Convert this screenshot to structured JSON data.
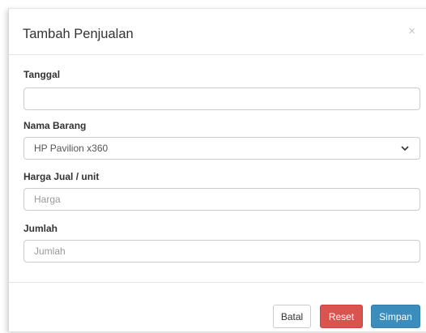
{
  "modal": {
    "title": "Tambah Penjualan",
    "close_symbol": "×"
  },
  "form": {
    "tanggal": {
      "label": "Tanggal",
      "value": "",
      "placeholder": ""
    },
    "nama_barang": {
      "label": "Nama Barang",
      "selected": "HP Pavilion x360"
    },
    "harga": {
      "label": "Harga Jual / unit",
      "value": "",
      "placeholder": "Harga"
    },
    "jumlah": {
      "label": "Jumlah",
      "value": "",
      "placeholder": "Jumlah"
    }
  },
  "footer": {
    "batal_label": "Batal",
    "reset_label": "Reset",
    "simpan_label": "Simpan"
  },
  "colors": {
    "danger": "#d9534f",
    "primary": "#3c8dbc"
  },
  "icons": {
    "close": "close-icon",
    "select_arrow": "chevron-down-icon"
  }
}
